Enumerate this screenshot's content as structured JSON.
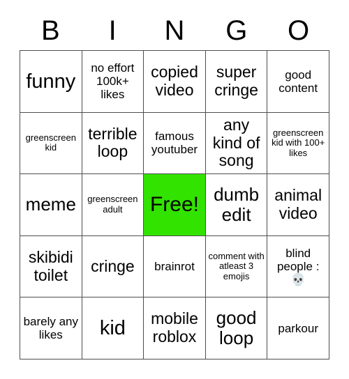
{
  "header": {
    "letters": [
      "B",
      "I",
      "N",
      "G",
      "O"
    ]
  },
  "grid": {
    "rows": 5,
    "columns": 5,
    "free_color": "#32e300",
    "border_color": "#4d4d4d",
    "background_color": "#ffffff",
    "cells": [
      [
        {
          "text": "funny",
          "size": "xl",
          "free": false
        },
        {
          "text": "no effort 100k+ likes",
          "size": "sm",
          "free": false
        },
        {
          "text": "copied video",
          "size": "md",
          "free": false
        },
        {
          "text": "super cringe",
          "size": "md",
          "free": false
        },
        {
          "text": "good content",
          "size": "sm",
          "free": false
        }
      ],
      [
        {
          "text": "greenscreen kid",
          "size": "xs",
          "free": false
        },
        {
          "text": "terrible loop",
          "size": "md",
          "free": false
        },
        {
          "text": "famous youtuber",
          "size": "sm",
          "free": false
        },
        {
          "text": "any kind of song",
          "size": "md",
          "free": false
        },
        {
          "text": "greenscreen kid with 100+ likes",
          "size": "xs",
          "free": false
        }
      ],
      [
        {
          "text": "meme",
          "size": "lg",
          "free": false
        },
        {
          "text": "greenscreen adult",
          "size": "xs",
          "free": false
        },
        {
          "text": "Free!",
          "size": "xl",
          "free": true
        },
        {
          "text": "dumb edit",
          "size": "lg",
          "free": false
        },
        {
          "text": "animal video",
          "size": "md",
          "free": false
        }
      ],
      [
        {
          "text": "skibidi toilet",
          "size": "md",
          "free": false
        },
        {
          "text": "cringe",
          "size": "md",
          "free": false
        },
        {
          "text": "brainrot",
          "size": "sm",
          "free": false
        },
        {
          "text": "comment with atleast 3 emojis",
          "size": "xs",
          "free": false
        },
        {
          "text": "blind people : 💀",
          "size": "sm",
          "free": false
        }
      ],
      [
        {
          "text": "barely any likes",
          "size": "sm",
          "free": false
        },
        {
          "text": "kid",
          "size": "xl",
          "free": false
        },
        {
          "text": "mobile roblox",
          "size": "md",
          "free": false
        },
        {
          "text": "good loop",
          "size": "lg",
          "free": false
        },
        {
          "text": "parkour",
          "size": "sm",
          "free": false
        }
      ]
    ]
  }
}
